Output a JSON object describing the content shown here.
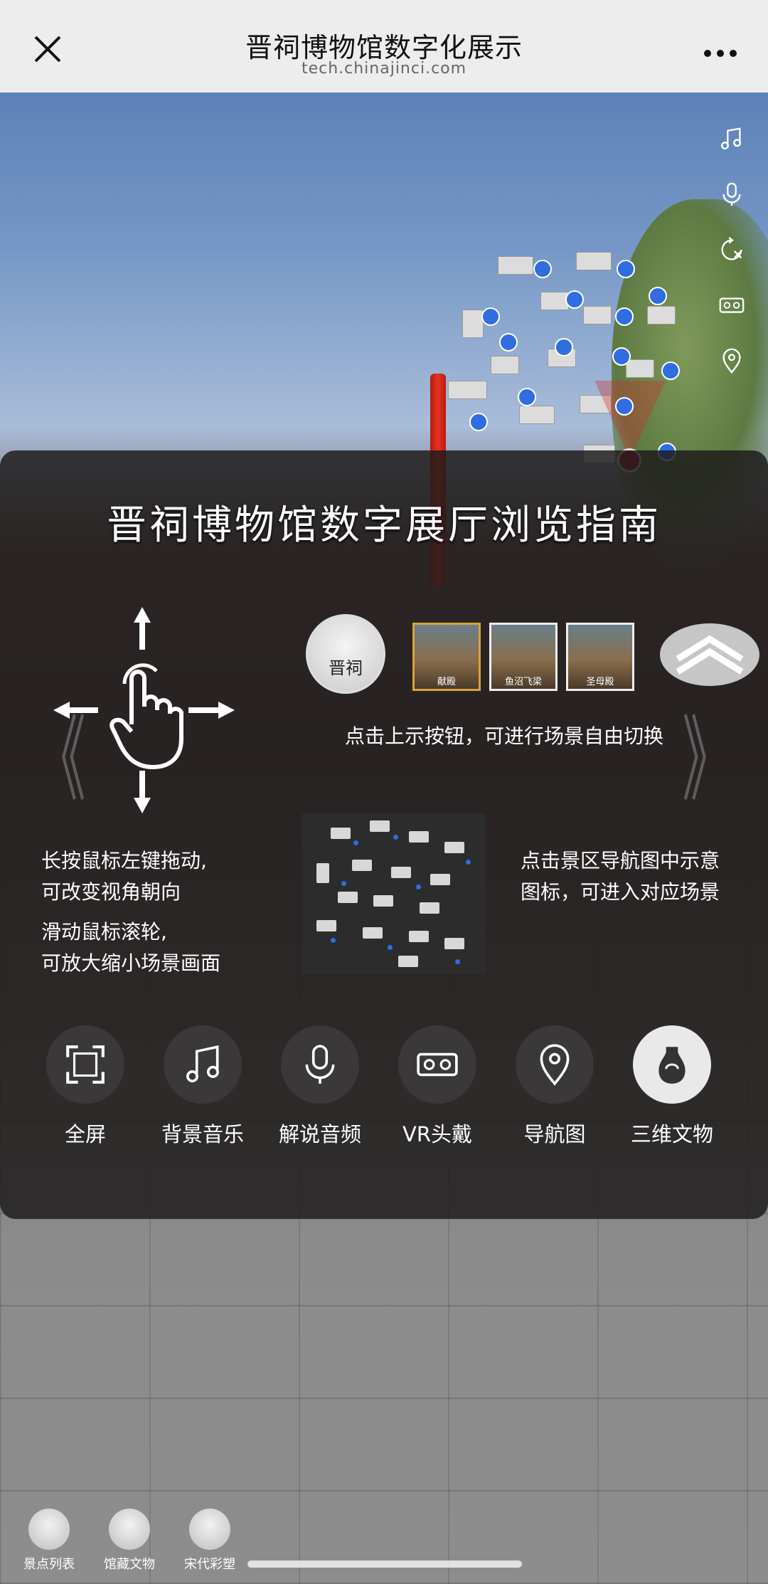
{
  "header": {
    "title": "晋祠博物馆数字化展示",
    "url": "tech.chinajinci.com",
    "close_icon": "close-icon",
    "more_icon": "more-icon"
  },
  "side_tools": [
    "music-icon",
    "mic-icon",
    "rotate-icon",
    "vr-icon",
    "location-icon"
  ],
  "guide": {
    "title": "晋祠博物馆数字展厅浏览指南",
    "drag_line1": "长按鼠标左键拖动,",
    "drag_line2": "可改变视角朝向",
    "scroll_line1": "滑动鼠标滚轮,",
    "scroll_line2": "可放大缩小场景画面",
    "switch_hint": "点击上示按钮，可进行场景自由切换",
    "map_line1": "点击景区导航图中示意",
    "map_line2": "图标，可进入对应场景",
    "logo_text": "晋祠",
    "thumbs": [
      {
        "label": "献殿"
      },
      {
        "label": "鱼沼飞梁"
      },
      {
        "label": "圣母殿"
      }
    ],
    "functions": [
      {
        "label": "全屏",
        "icon": "fullscreen-icon"
      },
      {
        "label": "背景音乐",
        "icon": "music-icon"
      },
      {
        "label": "解说音频",
        "icon": "mic-icon"
      },
      {
        "label": "VR头戴",
        "icon": "vr-headset-icon"
      },
      {
        "label": "导航图",
        "icon": "location-icon"
      },
      {
        "label": "三维文物",
        "icon": "vase-icon"
      }
    ]
  },
  "dock": {
    "items": [
      {
        "label": "景点列表"
      },
      {
        "label": "馆藏文物"
      },
      {
        "label": "宋代彩塑"
      }
    ]
  },
  "colors": {
    "accent_blue": "#2f6de0",
    "selected_border": "#d9a33a",
    "panel_bg": "#1e1c1c"
  }
}
